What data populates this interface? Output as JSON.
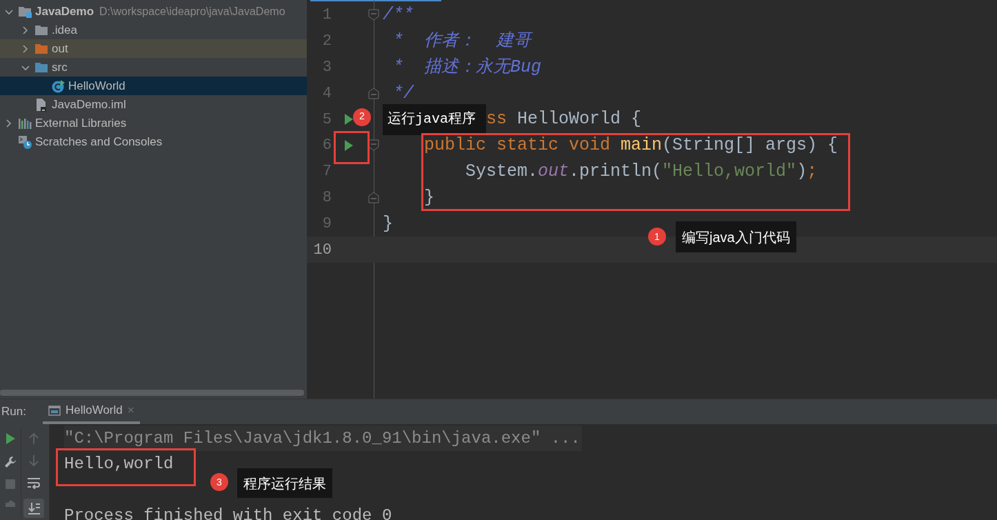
{
  "project_tree": [
    {
      "label": "JavaDemo",
      "path": "D:\\workspace\\ideapro\\java\\JavaDemo",
      "kind": "module",
      "expanded": true,
      "selected": false,
      "children": [
        {
          "label": ".idea",
          "kind": "folder",
          "expanded": false,
          "selected": false
        },
        {
          "label": "out",
          "kind": "folder-excluded",
          "expanded": false,
          "selected": false
        },
        {
          "label": "src",
          "kind": "folder-source",
          "expanded": true,
          "selected": false,
          "children": [
            {
              "label": "HelloWorld",
              "kind": "class",
              "selected": true
            }
          ]
        },
        {
          "label": "JavaDemo.iml",
          "kind": "file",
          "selected": false
        }
      ]
    },
    {
      "label": "External Libraries",
      "kind": "libraries",
      "expanded": false,
      "selected": false
    },
    {
      "label": "Scratches and Consoles",
      "kind": "scratches",
      "selected": false
    }
  ],
  "editor": {
    "lines": [
      {
        "number": "1",
        "current": false,
        "fold": {
          "kind": "start"
        },
        "tokens": [
          {
            "text": "/**",
            "kind": "doc"
          }
        ]
      },
      {
        "number": "2",
        "current": false,
        "tokens": [
          {
            "text": " *  作者：  建哥",
            "kind": "doc"
          }
        ]
      },
      {
        "number": "3",
        "current": false,
        "tokens": [
          {
            "text": " *  描述：永无Bug",
            "kind": "doc"
          }
        ]
      },
      {
        "number": "4",
        "current": false,
        "fold": {
          "kind": "end"
        },
        "tokens": [
          {
            "text": " */",
            "kind": "doc"
          }
        ]
      },
      {
        "number": "5",
        "current": false,
        "run": true,
        "annotation": {
          "number": "2",
          "text": "运行java程序"
        },
        "tokens": [
          {
            "text": "ss ",
            "kind": "keyword"
          },
          {
            "text": "HelloWorld {",
            "kind": "plain"
          }
        ]
      },
      {
        "number": "6",
        "current": false,
        "run": true,
        "fold": {
          "kind": "start"
        },
        "tokens": [
          {
            "text": "    public static void ",
            "kind": "keyword"
          },
          {
            "text": "main",
            "kind": "method"
          },
          {
            "text": "(String[] args) {",
            "kind": "plain"
          }
        ]
      },
      {
        "number": "7",
        "current": false,
        "tokens": [
          {
            "text": "        System.",
            "kind": "plain"
          },
          {
            "text": "out",
            "kind": "field"
          },
          {
            "text": ".println(",
            "kind": "plain"
          },
          {
            "text": "\"Hello,world\"",
            "kind": "string"
          },
          {
            "text": ")",
            "kind": "plain"
          },
          {
            "text": ";",
            "kind": "keyword"
          }
        ]
      },
      {
        "number": "8",
        "current": false,
        "fold": {
          "kind": "end"
        },
        "tokens": [
          {
            "text": "    }",
            "kind": "plain"
          }
        ]
      },
      {
        "number": "9",
        "current": false,
        "tokens": [
          {
            "text": "}",
            "kind": "plain"
          }
        ]
      },
      {
        "number": "10",
        "current": true
      }
    ],
    "annotation": {
      "number": "1",
      "text": "编写java入门代码"
    }
  },
  "run_panel": {
    "label": "Run:",
    "tabs": [
      {
        "label": "HelloWorld",
        "close": "×",
        "selected": true
      }
    ],
    "console": [
      {
        "text": "\"C:\\Program Files\\Java\\jdk1.8.0_91\\bin\\java.exe\" ...",
        "kind": "command"
      },
      {
        "text": "Hello,world",
        "kind": "output"
      },
      {
        "kind": "blank"
      },
      {
        "text": "Process finished with exit code 0",
        "kind": "output"
      }
    ],
    "annotation": {
      "number": "3",
      "text": "程序运行结果"
    }
  }
}
